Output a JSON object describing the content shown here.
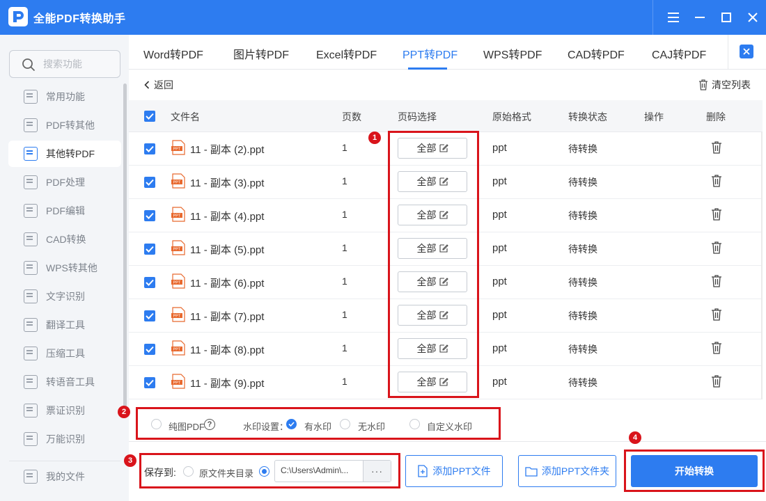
{
  "app": {
    "title": "全能PDF转换助手"
  },
  "search": {
    "placeholder": "搜索功能"
  },
  "sidebar": {
    "items": [
      {
        "label": "常用功能",
        "icon": "star-doc-icon"
      },
      {
        "label": "PDF转其他",
        "icon": "pdf-convert-icon"
      },
      {
        "label": "其他转PDF",
        "icon": "to-pdf-icon",
        "active": true
      },
      {
        "label": "PDF处理",
        "icon": "pdf-process-icon"
      },
      {
        "label": "PDF编辑",
        "icon": "pdf-edit-icon"
      },
      {
        "label": "CAD转换",
        "icon": "cad-icon"
      },
      {
        "label": "WPS转其他",
        "icon": "wps-icon"
      },
      {
        "label": "文字识别",
        "icon": "ocr-icon"
      },
      {
        "label": "翻译工具",
        "icon": "translate-icon"
      },
      {
        "label": "压缩工具",
        "icon": "compress-icon"
      },
      {
        "label": "转语音工具",
        "icon": "voice-icon"
      },
      {
        "label": "票证识别",
        "icon": "ticket-icon"
      },
      {
        "label": "万能识别",
        "icon": "recognize-icon"
      }
    ],
    "my_files": "我的文件"
  },
  "tabs": [
    "Word转PDF",
    "图片转PDF",
    "Excel转PDF",
    "PPT转PDF",
    "WPS转PDF",
    "CAD转PDF",
    "CAJ转PDF"
  ],
  "active_tab": "PPT转PDF",
  "toolbar": {
    "back": "返回",
    "clear": "清空列表"
  },
  "table": {
    "headers": {
      "name": "文件名",
      "pages": "页数",
      "page_select": "页码选择",
      "format": "原始格式",
      "status": "转换状态",
      "action": "操作",
      "delete": "删除"
    },
    "rows": [
      {
        "name": "11 - 副本 (2).ppt",
        "pages": "1",
        "page_select": "全部",
        "format": "ppt",
        "status": "待转换"
      },
      {
        "name": "11 - 副本 (3).ppt",
        "pages": "1",
        "page_select": "全部",
        "format": "ppt",
        "status": "待转换"
      },
      {
        "name": "11 - 副本 (4).ppt",
        "pages": "1",
        "page_select": "全部",
        "format": "ppt",
        "status": "待转换"
      },
      {
        "name": "11 - 副本 (5).ppt",
        "pages": "1",
        "page_select": "全部",
        "format": "ppt",
        "status": "待转换"
      },
      {
        "name": "11 - 副本 (6).ppt",
        "pages": "1",
        "page_select": "全部",
        "format": "ppt",
        "status": "待转换"
      },
      {
        "name": "11 - 副本 (7).ppt",
        "pages": "1",
        "page_select": "全部",
        "format": "ppt",
        "status": "待转换"
      },
      {
        "name": "11 - 副本 (8).ppt",
        "pages": "1",
        "page_select": "全部",
        "format": "ppt",
        "status": "待转换"
      },
      {
        "name": "11 - 副本 (9).ppt",
        "pages": "1",
        "page_select": "全部",
        "format": "ppt",
        "status": "待转换"
      }
    ],
    "file_icon_text": "PPT"
  },
  "options": {
    "pure_image": "纯图PDF",
    "watermark_label": "水印设置：",
    "with_watermark": "有水印",
    "no_watermark": "无水印",
    "custom_watermark": "自定义水印"
  },
  "save": {
    "label": "保存到:",
    "source_dir": "原文件夹目录",
    "path": "C:\\Users\\Admin\\...",
    "more": "···"
  },
  "buttons": {
    "add_file": "添加PPT文件",
    "add_folder": "添加PPT文件夹",
    "start": "开始转换"
  },
  "badges": [
    "1",
    "2",
    "3",
    "4"
  ],
  "colors": {
    "accent": "#2d7cf0",
    "highlight": "#d9141b",
    "ppt_orange": "#e8692e"
  }
}
